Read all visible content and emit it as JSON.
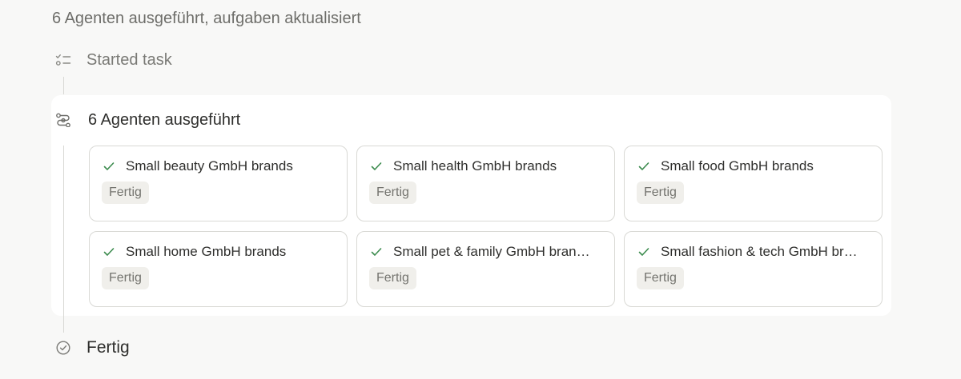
{
  "summary": "6 Agenten ausgeführt, aufgaben aktualisiert",
  "steps": {
    "started": {
      "label": "Started task",
      "icon": "task-list-icon"
    },
    "agents": {
      "label": "6 Agenten ausgeführt",
      "icon": "agents-flow-icon"
    },
    "done": {
      "label": "Fertig",
      "icon": "check-circle-icon"
    }
  },
  "agents": [
    {
      "title": "Small beauty GmbH brands",
      "status": "Fertig"
    },
    {
      "title": "Small health GmbH brands",
      "status": "Fertig"
    },
    {
      "title": "Small food GmbH brands",
      "status": "Fertig"
    },
    {
      "title": "Small home GmbH brands",
      "status": "Fertig"
    },
    {
      "title": "Small pet & family GmbH bran…",
      "status": "Fertig"
    },
    {
      "title": "Small fashion & tech GmbH br…",
      "status": "Fertig"
    }
  ],
  "colors": {
    "check": "#3d8c4f",
    "line": "#d9d9d5",
    "badge_bg": "#f0efeb"
  }
}
